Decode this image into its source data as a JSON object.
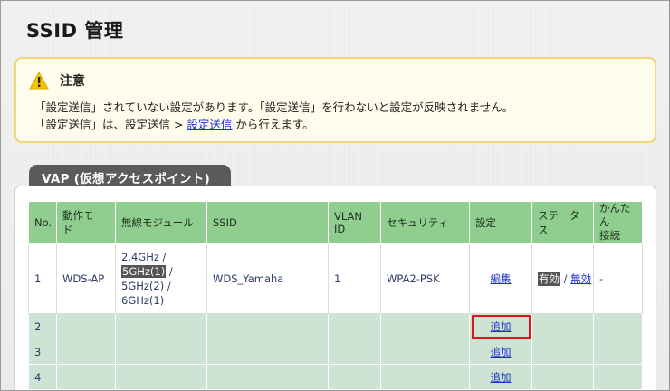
{
  "page": {
    "title": "SSID 管理"
  },
  "notice": {
    "title": "注意",
    "line1": "「設定送信」されていない設定があります。「設定送信」を行わないと設定が反映されません。",
    "line2_prefix": "「設定送信」は、設定送信 > ",
    "line2_link": "設定送信",
    "line2_suffix": " から行えます。"
  },
  "vap": {
    "tab_label": "VAP (仮想アクセスポイント)"
  },
  "table": {
    "headers": [
      "No.",
      "動作モード",
      "無線モジュール",
      "SSID",
      "VLAN ID",
      "セキュリティ",
      "設定",
      "ステータス",
      "かんたん\n接続"
    ],
    "row1": {
      "no": "1",
      "mode": "WDS-AP",
      "module": [
        "2.4GHz /",
        "5GHz(1)",
        " /",
        "5GHz(2) /",
        "6GHz(1)"
      ],
      "ssid": "WDS_Yamaha",
      "vlan": "1",
      "security": "WPA2-PSK",
      "edit_link": "編集",
      "status_enabled": "有効",
      "status_sep": " / ",
      "status_disable_link": "無効",
      "easy": "-"
    },
    "empty_rows": [
      {
        "no": "2",
        "add_link": "追加"
      },
      {
        "no": "3",
        "add_link": "追加"
      },
      {
        "no": "4",
        "add_link": "追加"
      }
    ]
  },
  "colors": {
    "header_green": "#8fce8e",
    "empty_row": "#cde3d3",
    "highlight_red": "#e0141e",
    "link_blue": "#1b2fc9",
    "notice_border": "#f2d675"
  },
  "icons": {
    "notice": "warning-triangle-icon"
  }
}
